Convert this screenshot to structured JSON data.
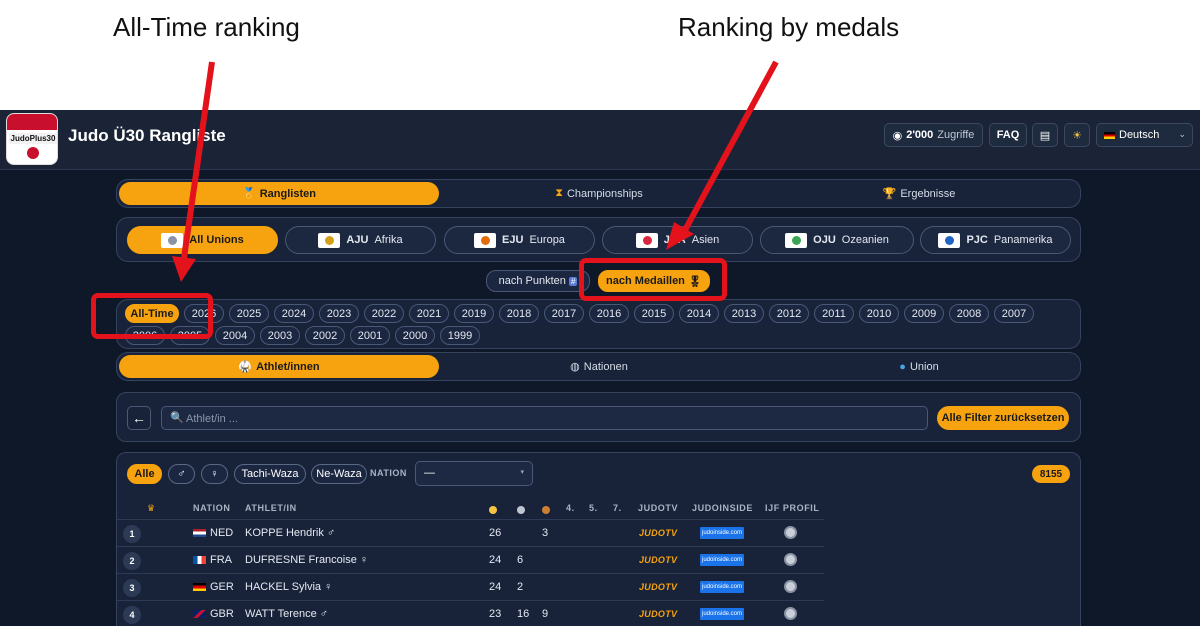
{
  "annotations": {
    "left": "All-Time ranking",
    "right": "Ranking by medals"
  },
  "header": {
    "title": "Judo Ü30 Rangliste",
    "logo_text": "JudoPlus30",
    "views": "2'000",
    "views_label": "Zugriffe",
    "faq": "FAQ",
    "language": "Deutsch"
  },
  "main_tabs": [
    {
      "label": "Ranglisten",
      "icon": "trophy-icon",
      "active": true
    },
    {
      "label": "Championships",
      "icon": "hourglass-icon",
      "active": false
    },
    {
      "label": "Ergebnisse",
      "icon": "cup-icon",
      "active": false
    }
  ],
  "unions": [
    {
      "code": "",
      "name": "All Unions",
      "active": true,
      "color": "#f6a30f"
    },
    {
      "code": "AJU",
      "name": "Afrika",
      "active": false,
      "color": "#d4a017"
    },
    {
      "code": "EJU",
      "name": "Europa",
      "active": false,
      "color": "#e36c0a"
    },
    {
      "code": "JUA",
      "name": "Asien",
      "active": false,
      "color": "#d7263d"
    },
    {
      "code": "OJU",
      "name": "Ozeanien",
      "active": false,
      "color": "#3aa655"
    },
    {
      "code": "PJC",
      "name": "Panamerika",
      "active": false,
      "color": "#2264c4"
    }
  ],
  "sort": {
    "points": "nach Punkten",
    "medals": "nach Medaillen"
  },
  "years_row1": [
    "All-Time",
    "2026",
    "2025",
    "2024",
    "2023",
    "2022",
    "2021",
    "2019",
    "2018",
    "2017",
    "2016",
    "2015",
    "2014",
    "2013",
    "2012",
    "2011",
    "2010",
    "2009",
    "2008",
    "2007"
  ],
  "years_row2": [
    "2006",
    "2005",
    "2004",
    "2003",
    "2002",
    "2001",
    "2000",
    "1999"
  ],
  "sub_tabs": [
    {
      "label": "Athlet/innen",
      "active": true
    },
    {
      "label": "Nationen",
      "active": false
    },
    {
      "label": "Union",
      "active": false
    }
  ],
  "search": {
    "placeholder": "Athlet/in ...",
    "reset": "Alle Filter zurücksetzen"
  },
  "filters": {
    "all": "Alle",
    "male": "♂",
    "female": "♀",
    "tachi": "Tachi-Waza",
    "ne": "Ne-Waza",
    "nation_label": "NATION",
    "nation_value": "—",
    "count": "8155"
  },
  "table": {
    "headers": {
      "nation": "NATION",
      "athlete": "ATHLET/IN",
      "fourth": "4.",
      "fifth": "5.",
      "seventh": "7.",
      "judotv": "JUDOTV",
      "judoinside": "JUDOINSIDE",
      "ijf": "IJF PROFIL"
    },
    "rows": [
      {
        "rank": "1",
        "nation": "NED",
        "name": "KOPPE Hendrik ♂",
        "gold": "26",
        "silver": "",
        "bronze": "3",
        "judotv": "JUDOTV",
        "judoinside": "judoinside.com"
      },
      {
        "rank": "2",
        "nation": "FRA",
        "name": "DUFRESNE Francoise ♀",
        "gold": "24",
        "silver": "6",
        "bronze": "",
        "judotv": "JUDOTV",
        "judoinside": "judoinside.com"
      },
      {
        "rank": "3",
        "nation": "GER",
        "name": "HACKEL Sylvia ♀",
        "gold": "24",
        "silver": "2",
        "bronze": "",
        "judotv": "JUDOTV",
        "judoinside": "judoinside.com"
      },
      {
        "rank": "4",
        "nation": "GBR",
        "name": "WATT Terence ♂",
        "gold": "23",
        "silver": "16",
        "bronze": "9",
        "judotv": "JUDOTV",
        "judoinside": "judoinside.com"
      }
    ]
  },
  "colors": {
    "accent": "#f6a30f",
    "annotation": "#e3121b",
    "background": "#0f1828"
  }
}
